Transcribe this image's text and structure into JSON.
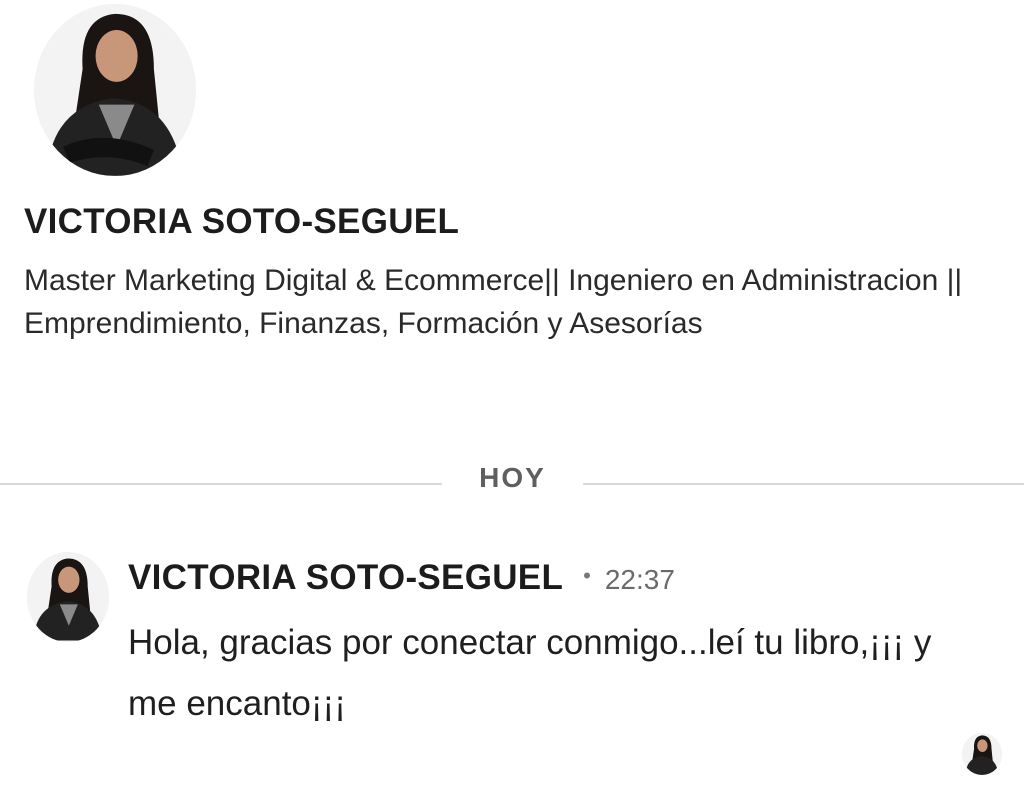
{
  "profile": {
    "name": "VICTORIA SOTO-SEGUEL",
    "headline": "Master Marketing Digital & Ecommerce|| Ingeniero en Administracion || Emprendimiento, Finanzas, Formación y Asesorías",
    "avatar_icon": "profile-photo"
  },
  "conversation": {
    "date_label": "HOY",
    "messages": [
      {
        "sender": "VICTORIA SOTO-SEGUEL",
        "separator": "•",
        "time": "22:37",
        "text": "Hola, gracias por conectar conmigo...leí tu libro,¡¡¡ y me encanto¡¡¡"
      }
    ],
    "read_receipt_icon": "seen-avatar"
  },
  "colors": {
    "background": "#ffffff",
    "text": "#1f1f1f",
    "muted": "#6b6b6b",
    "divider": "#d9d9d9",
    "outfit": "#222222",
    "hair": "#1a1412",
    "skin": "#c89678"
  }
}
